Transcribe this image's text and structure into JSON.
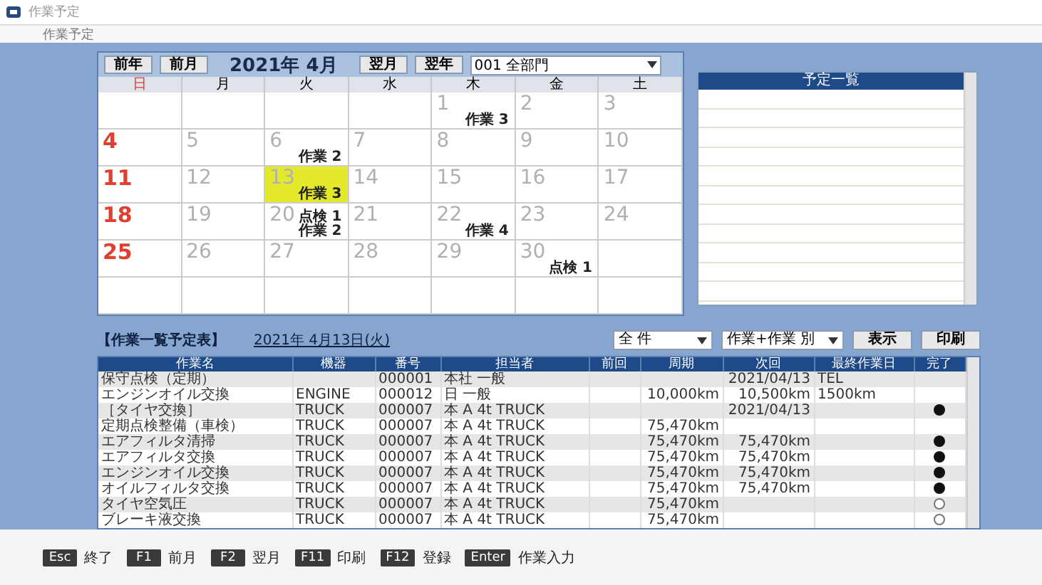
{
  "window": {
    "title": "作業予定"
  },
  "menu": [
    "作業予定"
  ],
  "calendar": {
    "buttons_left": [
      "前年",
      "前月"
    ],
    "month": "2021年 4月",
    "buttons_right": [
      "翌月",
      "翌年"
    ],
    "department": "001 全部門",
    "weekdays": [
      "日",
      "月",
      "火",
      "水",
      "木",
      "金",
      "土"
    ],
    "weeks": [
      [
        {
          "kind": "blank"
        },
        {
          "kind": "blank"
        },
        {
          "kind": "blank"
        },
        {
          "kind": "blank"
        },
        {
          "kind": "day",
          "day": "1",
          "selected": false,
          "notes": [
            "作業 3"
          ]
        },
        {
          "kind": "day",
          "day": "2",
          "selected": false
        },
        {
          "kind": "day",
          "day": "3",
          "selected": false
        }
      ],
      [
        {
          "kind": "day",
          "day": "4",
          "selected": false
        },
        {
          "kind": "day",
          "day": "5",
          "selected": false
        },
        {
          "kind": "day",
          "day": "6",
          "selected": false,
          "notes": [
            "作業 2"
          ]
        },
        {
          "kind": "day",
          "day": "7",
          "selected": false
        },
        {
          "kind": "day",
          "day": "8",
          "selected": false
        },
        {
          "kind": "day",
          "day": "9",
          "selected": false
        },
        {
          "kind": "day",
          "day": "10",
          "selected": false
        }
      ],
      [
        {
          "kind": "day",
          "day": "11",
          "selected": false
        },
        {
          "kind": "day",
          "day": "12",
          "selected": false
        },
        {
          "kind": "day",
          "day": "13",
          "selected": true,
          "notes": [
            "作業 3"
          ]
        },
        {
          "kind": "day",
          "day": "14",
          "selected": false
        },
        {
          "kind": "day",
          "day": "15",
          "selected": false
        },
        {
          "kind": "day",
          "day": "16",
          "selected": false
        },
        {
          "kind": "day",
          "day": "17",
          "selected": false
        }
      ],
      [
        {
          "kind": "day",
          "day": "18",
          "selected": false
        },
        {
          "kind": "day",
          "day": "19",
          "selected": false
        },
        {
          "kind": "day",
          "day": "20",
          "selected": false,
          "notes": [
            "点検 1",
            "作業 2"
          ]
        },
        {
          "kind": "day",
          "day": "21",
          "selected": false
        },
        {
          "kind": "day",
          "day": "22",
          "selected": false,
          "notes": [
            "作業 4"
          ]
        },
        {
          "kind": "day",
          "day": "23",
          "selected": false
        },
        {
          "kind": "day",
          "day": "24",
          "selected": false
        }
      ],
      [
        {
          "kind": "day",
          "day": "25",
          "selected": false
        },
        {
          "kind": "day",
          "day": "26",
          "selected": false
        },
        {
          "kind": "day",
          "day": "27",
          "selected": false
        },
        {
          "kind": "day",
          "day": "28",
          "selected": false
        },
        {
          "kind": "day",
          "day": "29",
          "selected": false
        },
        {
          "kind": "day",
          "day": "30",
          "selected": false,
          "notes": [
            "点検 1"
          ]
        },
        {
          "kind": "blank"
        }
      ],
      [
        {
          "kind": "blank"
        },
        {
          "kind": "blank"
        },
        {
          "kind": "blank"
        },
        {
          "kind": "blank"
        },
        {
          "kind": "blank"
        },
        {
          "kind": "blank"
        },
        {
          "kind": "blank"
        }
      ]
    ]
  },
  "schedule_panel": {
    "title": "予定一覧"
  },
  "tasks": {
    "title": "【作業一覧予定表】",
    "date": "2021年 4月13日(火)",
    "filter": "全 件",
    "sort": "作業+作業 別",
    "buttons": [
      "表示",
      "印刷"
    ],
    "columns": [
      "作業名",
      "機器",
      "番号",
      "担当者",
      "前回",
      "周期",
      "次回",
      "最終作業日",
      "完了"
    ],
    "rows": [
      {
        "name": "保守点検（定期）",
        "number": "000001",
        "staff": "本社 一般",
        "next": "2021/04/13",
        "last": "TEL"
      },
      {
        "name": "エンジンオイル交換",
        "device": "ENGINE",
        "number": "000012",
        "staff": "日 一般",
        "cycle": "10,000km",
        "next": "10,500km",
        "last": "1500km"
      },
      {
        "name": "［タイヤ交換］",
        "device": "TRUCK",
        "number": "000007",
        "staff": "本 A 4t TRUCK",
        "next": "2021/04/13",
        "done": true
      },
      {
        "name": "定期点検整備（車検）",
        "device": "TRUCK",
        "number": "000007",
        "staff": "本 A 4t TRUCK",
        "cycle": "75,470km"
      },
      {
        "name": "エアフィルタ清掃",
        "device": "TRUCK",
        "number": "000007",
        "staff": "本 A 4t TRUCK",
        "cycle": "75,470km",
        "next": "75,470km",
        "done": true
      },
      {
        "name": "エアフィルタ交換",
        "device": "TRUCK",
        "number": "000007",
        "staff": "本 A 4t TRUCK",
        "cycle": "75,470km",
        "next": "75,470km",
        "done": true
      },
      {
        "name": "エンジンオイル交換",
        "device": "TRUCK",
        "number": "000007",
        "staff": "本 A 4t TRUCK",
        "cycle": "75,470km",
        "next": "75,470km",
        "done": true
      },
      {
        "name": "オイルフィルタ交換",
        "device": "TRUCK",
        "number": "000007",
        "staff": "本 A 4t TRUCK",
        "cycle": "75,470km",
        "next": "75,470km",
        "done": true
      },
      {
        "name": "タイヤ空気圧",
        "device": "TRUCK",
        "number": "000007",
        "staff": "本 A 4t TRUCK",
        "cycle": "75,470km",
        "done": false
      },
      {
        "name": "ブレーキ液交換",
        "device": "TRUCK",
        "number": "000007",
        "staff": "本 A 4t TRUCK",
        "cycle": "75,470km",
        "done": false
      }
    ]
  },
  "function_keys": [
    {
      "key": "Esc",
      "label": "終了"
    },
    {
      "key": "F1",
      "label": "前月"
    },
    {
      "key": "F2",
      "label": "翌月"
    },
    {
      "key": "F11",
      "label": "印刷"
    },
    {
      "key": "F12",
      "label": "登録"
    },
    {
      "key": "Enter",
      "label": "作業入力"
    }
  ]
}
